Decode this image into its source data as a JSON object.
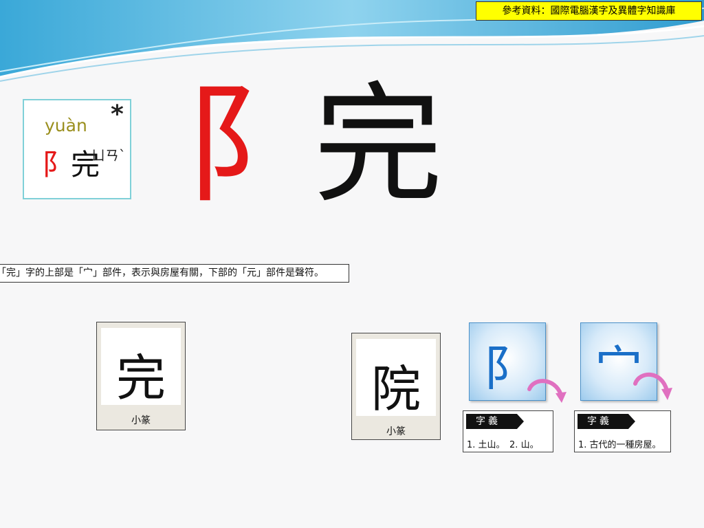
{
  "source_note": "參考資料：國際電腦漢字及異體字知識庫",
  "pinyin_card": {
    "pinyin": "yuàn",
    "marker": "*",
    "radical_part": "阝",
    "phonetic_part": "完",
    "zhuyin": "ㄩㄢˋ"
  },
  "main_character": {
    "radical_part": "阝",
    "phonetic_part": "完"
  },
  "explanation": "「完」字的上部是「宀」部件，表示與房屋有關，下部的「元」部件是聲符。",
  "seal_cards": [
    {
      "glyph": "完",
      "caption": "小篆"
    },
    {
      "glyph": "院",
      "caption": "小篆"
    }
  ],
  "component_cards": [
    {
      "glyph": "阝",
      "icon": "curved-arrow-icon",
      "meaning_heading": "字義",
      "meaning_text": "1. 土山。　2. 山。"
    },
    {
      "glyph": "宀",
      "icon": "curved-arrow-icon",
      "meaning_heading": "字義",
      "meaning_text": "1. 古代的一種房屋。"
    }
  ],
  "colors": {
    "radical_red": "#e51919",
    "component_blue": "#1a6fc8",
    "arrow_pink": "#e070c0",
    "note_yellow": "#ffff00"
  }
}
